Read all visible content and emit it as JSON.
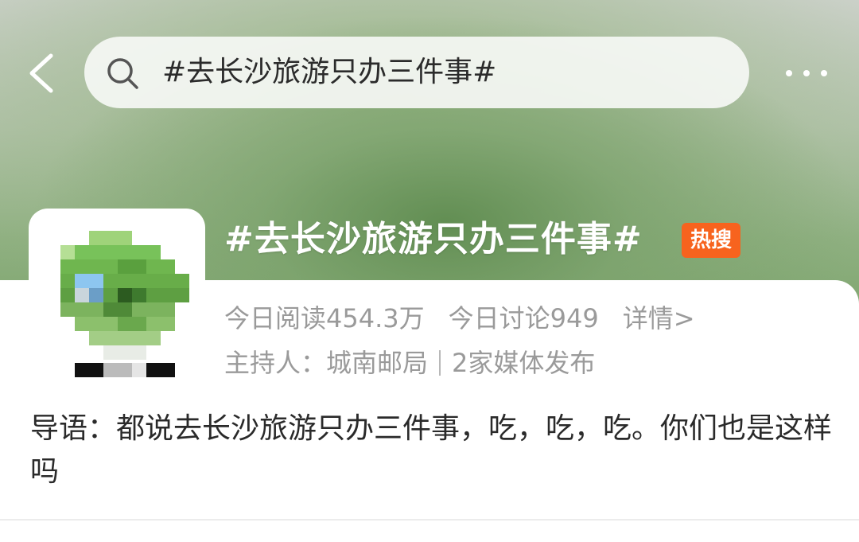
{
  "search": {
    "query": "#去长沙旅游只办三件事#"
  },
  "topic": {
    "title": "#去长沙旅游只办三件事#",
    "badge": "热搜",
    "reads": "今日阅读454.3万",
    "discussions": "今日讨论949",
    "details_link": "详情>",
    "host": "主持人：城南邮局",
    "media": "2家媒体发布",
    "intro": "导语：都说去长沙旅游只办三件事，吃，吃，吃。你们也是这样吗"
  },
  "colors": {
    "hot_badge": "#f7631e",
    "hero_green": "#7fa66f"
  },
  "icons": {
    "back": "chevron-left-icon",
    "search": "search-icon",
    "more": "more-dots-icon"
  }
}
